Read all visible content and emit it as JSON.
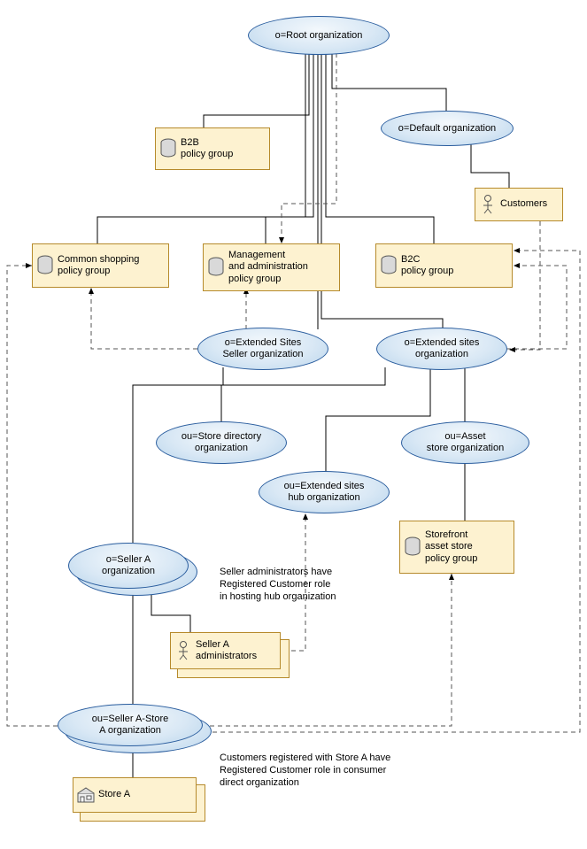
{
  "nodes": {
    "root": {
      "label": "o=Root organization"
    },
    "default_o": {
      "label": "o=Default organization"
    },
    "customers": {
      "label": "Customers"
    },
    "b2b_pg": {
      "label": "B2B\npolicy group"
    },
    "common_pg": {
      "label": "Common shopping\npolicy group"
    },
    "mgmt_pg": {
      "label": "Management\nand administration\npolicy group"
    },
    "b2c_pg": {
      "label": "B2C\npolicy group"
    },
    "ext_seller": {
      "label": "o=Extended Sites\nSeller organization"
    },
    "ext_sites": {
      "label": "o=Extended sites\norganization"
    },
    "store_dir": {
      "label": "ou=Store directory\norganization"
    },
    "ext_hub": {
      "label": "ou=Extended sites\nhub organization"
    },
    "asset_org": {
      "label": "ou=Asset\nstore organization"
    },
    "storefront_pg": {
      "label": "Storefront\nasset store\npolicy group"
    },
    "seller_a": {
      "label": "o=Seller A\norganization"
    },
    "seller_a_admins": {
      "label": "Seller A\nadministrators"
    },
    "seller_a_store": {
      "label": "ou=Seller A-Store\nA organization"
    },
    "store_a": {
      "label": "Store A"
    }
  },
  "notes": {
    "admin_note": "Seller administrators have\nRegistered Customer role\nin hosting hub organization",
    "cust_note": "Customers registered with Store A have\nRegistered Customer role in consumer\ndirect organization"
  },
  "chart_data": {
    "type": "org-hierarchy-with-policy-subscriptions",
    "organizations": [
      "Root organization",
      "Default organization",
      "Extended Sites Seller organization",
      "Extended sites organization",
      "Store directory organization",
      "Extended sites hub organization",
      "Asset store organization",
      "Seller A organization",
      "Seller A-Store A organization"
    ],
    "policy_groups": [
      "B2B policy group",
      "Common shopping policy group",
      "Management and administration policy group",
      "B2C policy group",
      "Storefront asset store policy group"
    ],
    "actors": [
      "Customers",
      "Seller A administrators",
      "Store A"
    ],
    "solid_edges": [
      [
        "Root organization",
        "B2B policy group"
      ],
      [
        "Root organization",
        "Default organization"
      ],
      [
        "Root organization",
        "Common shopping policy group"
      ],
      [
        "Root organization",
        "Management and administration policy group"
      ],
      [
        "Root organization",
        "B2C policy group"
      ],
      [
        "Root organization",
        "Extended Sites Seller organization"
      ],
      [
        "Root organization",
        "Extended sites organization"
      ],
      [
        "Default organization",
        "Customers"
      ],
      [
        "Extended Sites Seller organization",
        "Seller A organization"
      ],
      [
        "Extended sites organization",
        "Store directory organization"
      ],
      [
        "Extended sites organization",
        "Extended sites hub organization"
      ],
      [
        "Extended sites organization",
        "Asset store organization"
      ],
      [
        "Asset store organization",
        "Storefront asset store policy group"
      ],
      [
        "Seller A organization",
        "Seller A administrators"
      ],
      [
        "Seller A organization",
        "Seller A-Store A organization"
      ],
      [
        "Seller A-Store A organization",
        "Store A"
      ]
    ],
    "dashed_edges": [
      [
        "Root organization",
        "Management and administration policy group"
      ],
      [
        "Extended Sites Seller organization",
        "Common shopping policy group"
      ],
      [
        "Extended Sites Seller organization",
        "Management and administration policy group"
      ],
      [
        "Extended sites organization",
        "B2C policy group"
      ],
      [
        "Seller A administrators",
        "Extended sites hub organization"
      ],
      [
        "Seller A-Store A organization",
        "Common shopping policy group"
      ],
      [
        "Seller A-Store A organization",
        "Storefront asset store policy group"
      ],
      [
        "Seller A-Store A organization",
        "B2C policy group"
      ],
      [
        "Customers",
        "Extended sites organization"
      ]
    ],
    "notes": [
      "Seller administrators have Registered Customer role in hosting hub organization",
      "Customers registered with Store A have Registered Customer role in consumer direct organization"
    ]
  }
}
